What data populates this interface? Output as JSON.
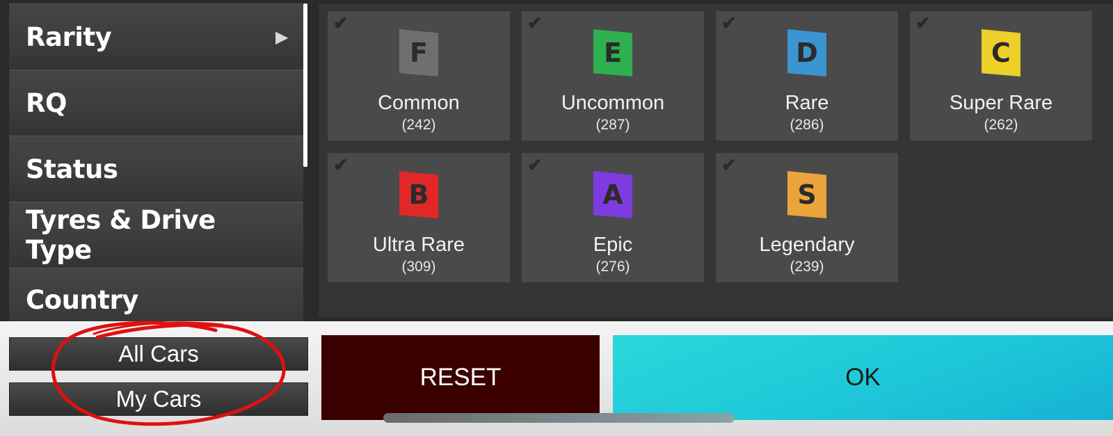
{
  "sidebar": {
    "items": [
      {
        "label": "Rarity",
        "arrow": "▶"
      },
      {
        "label": "RQ"
      },
      {
        "label": "Status"
      },
      {
        "label": "Tyres & Drive Type"
      },
      {
        "label": "Country"
      }
    ]
  },
  "rarity_tiles": [
    {
      "grade": "F",
      "name": "Common",
      "count": "(242)",
      "color": "#6f6f6f"
    },
    {
      "grade": "E",
      "name": "Uncommon",
      "count": "(287)",
      "color": "#2fb04f"
    },
    {
      "grade": "D",
      "name": "Rare",
      "count": "(286)",
      "color": "#3a95d0"
    },
    {
      "grade": "C",
      "name": "Super Rare",
      "count": "(262)",
      "color": "#efcf2a"
    },
    {
      "grade": "B",
      "name": "Ultra Rare",
      "count": "(309)",
      "color": "#e02828"
    },
    {
      "grade": "A",
      "name": "Epic",
      "count": "(276)",
      "color": "#7e3be0"
    },
    {
      "grade": "S",
      "name": "Legendary",
      "count": "(239)",
      "color": "#eba43a"
    }
  ],
  "check_icon": "✔",
  "bottom": {
    "all_cars": "All Cars",
    "my_cars": "My Cars",
    "reset": "RESET",
    "ok": "OK"
  },
  "colors": {
    "reset_bg": "#3a0000",
    "ok_bg": "#22c9d8",
    "annotation": "#e01010"
  }
}
